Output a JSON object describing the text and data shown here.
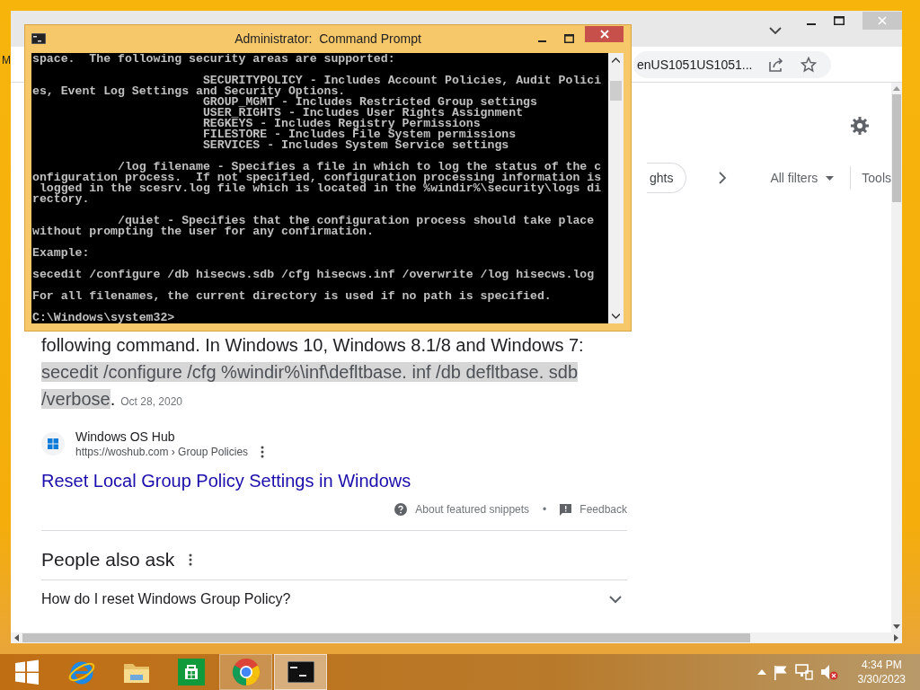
{
  "desktop": {
    "edge_letter": "M"
  },
  "browser": {
    "address": "enUS1051US1051...",
    "filters": {
      "chip": "ghts",
      "all_filters": "All filters",
      "tools": "Tools"
    },
    "snippet": {
      "lead": "following command. In Windows 10, Windows 8.1/8 and Windows 7: ",
      "highlighted": "secedit /configure /cfg %windir%\\inf\\defltbase. inf /db defltbase. sdb /verbose",
      "tail": ".",
      "date": "Oct 28, 2020"
    },
    "source": {
      "site": "Windows OS Hub",
      "url": "https://woshub.com › Group Policies"
    },
    "result_link": "Reset Local Group Policy Settings in Windows",
    "snippet_footer": {
      "about": "About featured snippets",
      "separator": "•",
      "feedback": "Feedback"
    },
    "people_also_ask": {
      "title": "People also ask",
      "questions": [
        {
          "text": "How do I reset Windows Group Policy?",
          "expanded": false
        }
      ]
    }
  },
  "console": {
    "title": "Administrator:  Command Prompt",
    "paragraphs": [
      [
        "space.  The following security areas are supported:"
      ],
      [
        "                        SECURITYPOLICY - Includes Account Policies, Audit Polici",
        "es, Event Log Settings and Security Options.",
        "                        GROUP_MGMT - Includes Restricted Group settings",
        "                        USER_RIGHTS - Includes User Rights Assignment",
        "                        REGKEYS - Includes Registry Permissions",
        "                        FILESTORE - Includes File System permissions",
        "                        SERVICES - Includes System Service settings"
      ],
      [
        "            /log filename - Specifies a file in which to log the status of the c",
        "onfiguration process.  If not specified, configuration processing information is",
        " logged in the scesrv.log file which is located in the %windir%\\security\\logs di",
        "rectory."
      ],
      [
        "            /quiet - Specifies that the configuration process should take place",
        "without prompting the user for any confirmation."
      ],
      [
        "Example:"
      ],
      [
        "secedit /configure /db hisecws.sdb /cfg hisecws.inf /overwrite /log hisecws.log"
      ],
      [
        "For all filenames, the current directory is used if no path is specified."
      ],
      [
        "C:\\Windows\\system32>"
      ]
    ]
  },
  "taskbar": {
    "apps": [
      {
        "kind": "start",
        "running": false,
        "selected": false
      },
      {
        "kind": "ie",
        "running": false,
        "selected": false
      },
      {
        "kind": "explorer",
        "running": false,
        "selected": false
      },
      {
        "kind": "store",
        "running": false,
        "selected": false
      },
      {
        "kind": "chrome",
        "running": true,
        "selected": false
      },
      {
        "kind": "cmd",
        "running": true,
        "selected": true
      }
    ],
    "clock": {
      "time": "4:34 PM",
      "date": "3/30/2023"
    }
  }
}
